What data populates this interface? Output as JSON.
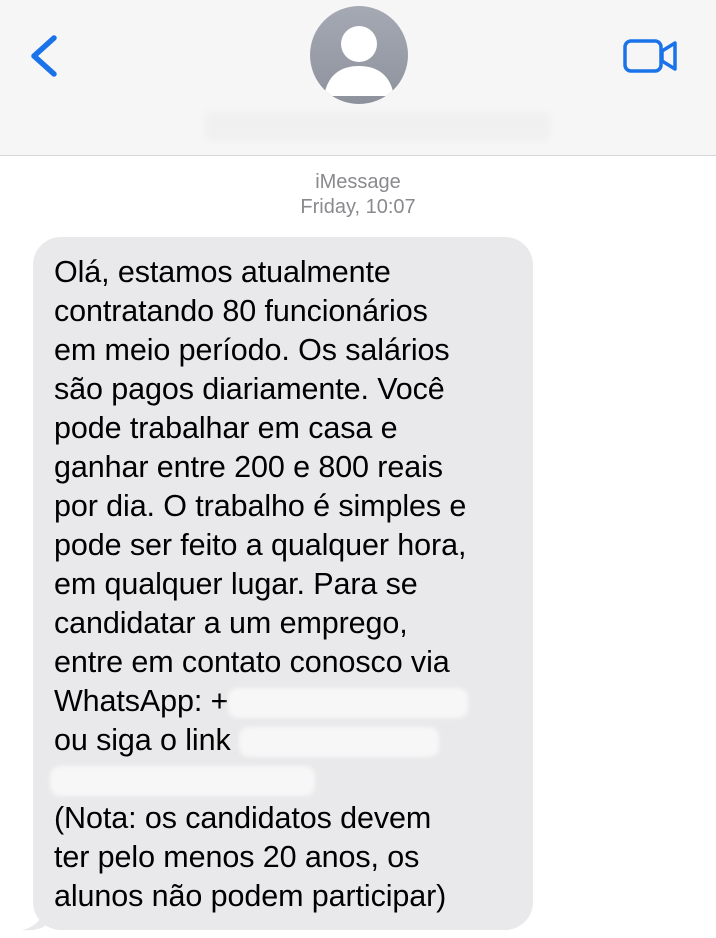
{
  "header": {
    "back_icon": "chevron-left-icon",
    "video_icon": "video-camera-icon",
    "accent_color": "#1a73e8"
  },
  "meta": {
    "service": "iMessage",
    "timestamp": "Friday, 10:07"
  },
  "message": {
    "lines": [
      "Olá, estamos atualmente",
      "contratando 80 funcionários",
      "em meio período. Os salários",
      "são pagos diariamente. Você",
      "pode trabalhar em casa e",
      "ganhar entre 200 e 800 reais",
      "por dia. O trabalho é simples e",
      "pode ser feito a qualquer hora,",
      "em qualquer lugar. Para se",
      "candidatar a um emprego,",
      "entre em contato conosco via",
      "WhatsApp: +",
      "ou siga o link",
      "",
      " (Nota: os candidatos devem",
      "ter pelo menos 20 anos, os",
      "alunos não podem participar)"
    ]
  }
}
